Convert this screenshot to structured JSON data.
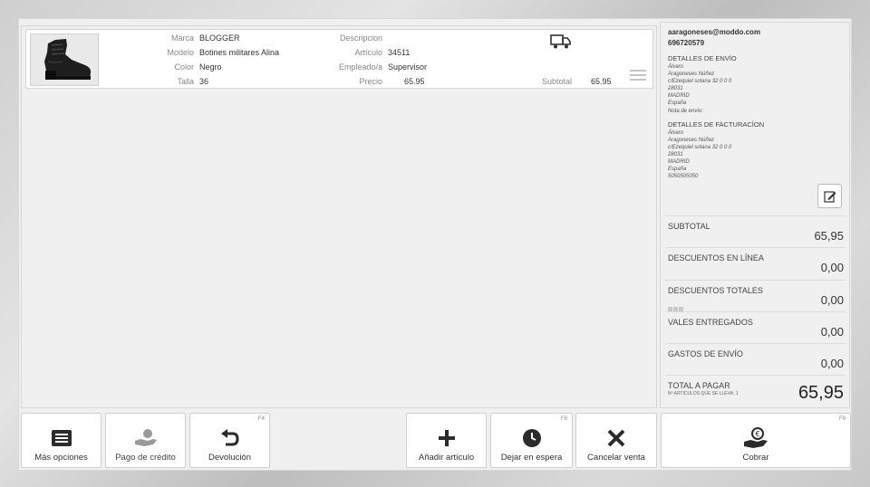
{
  "line_item": {
    "marca_label": "Marca",
    "marca": "BLOGGER",
    "modelo_label": "Modelo",
    "modelo": "Botines militares Alina",
    "color_label": "Color",
    "color": "Negro",
    "talla_label": "Talla",
    "talla": "36",
    "descripcion_label": "Descripcion",
    "articulo_label": "Artículo",
    "articulo": "34511",
    "empleado_label": "Empleado/a",
    "empleado": "Supervisor",
    "precio_label": "Precio",
    "precio": "65.95",
    "subtotal_label": "Subtotal",
    "subtotal": "65.95",
    "icons": [
      "boot-image",
      "truck-icon",
      "drag-handle-icon"
    ]
  },
  "customer": {
    "email": "aaragoneses@moddo.com",
    "phone": "696720579",
    "shipping_title": "DETALLES DE ENVÍO",
    "shipping_lines": [
      "Álvaro",
      "Aragoneses Núñez",
      "c/Ezequiel solana 32 0 0 0",
      "28031",
      "MADRID",
      "España",
      "Nota de envío:"
    ],
    "billing_title": "DETALLES DE FACTURACÍON",
    "billing_lines": [
      "Álvaro",
      "Aragoneses Núñez",
      "c/Ezequiel solana 32 0 0 0",
      "28031",
      "MADRID",
      "España",
      "5050505050"
    ]
  },
  "totals": {
    "subtotal_label": "SUBTOTAL",
    "subtotal": "65,95",
    "desc_linea_label": "DESCUENTOS EN LÍNEA",
    "desc_linea": "0,00",
    "desc_total_label": "DESCUENTOS TOTALES",
    "desc_total": "0,00",
    "vales_label": "VALES ENTREGADOS",
    "vales": "0,00",
    "envio_label": "GASTOS DE ENVÍO",
    "envio": "0,00",
    "total_label": "TOTAL A PAGAR",
    "total_sub": "Nº ARTÍCULOS QUE SE LLEVA: 1",
    "total": "65,95"
  },
  "buttons": {
    "mas_opciones": "Más opciones",
    "pago_credito": "Pago de crédito",
    "devolucion": "Devolución",
    "devolucion_key": "F4",
    "anadir": "Añadir artículo",
    "espera": "Dejar en espera",
    "espera_key": "F8",
    "cancelar": "Cancelar venta",
    "cobrar": "Cobrar",
    "cobrar_key": "F9"
  },
  "colors": {
    "icon": "#2b2b2b",
    "disabled_icon": "#9a9a9a",
    "panel": "#f0f0f0"
  }
}
